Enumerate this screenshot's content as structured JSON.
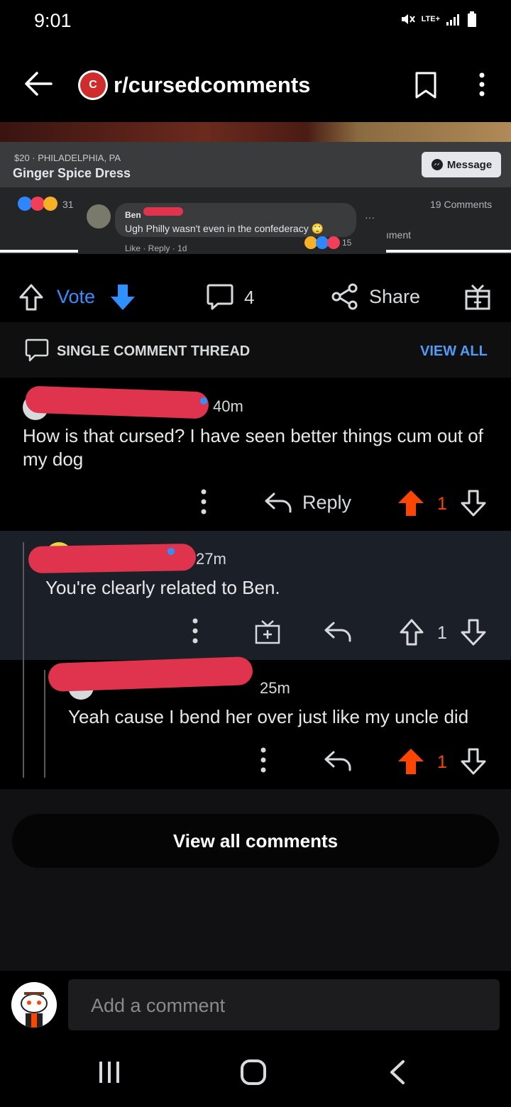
{
  "status_bar": {
    "time": "9:01",
    "network": "LTE+"
  },
  "header": {
    "subreddit": "r/cursedcomments",
    "logo_letter": "C"
  },
  "embed": {
    "price_location": "$20 · PHILADELPHIA, PA",
    "listing_title": "Ginger Spice Dress",
    "message_button": "Message",
    "reaction_count": "31",
    "comments_count": "19 Comments",
    "commenter_name": "Ben",
    "comment_text": "Ugh Philly wasn't even in the confederacy 🙄",
    "comment_actions": "Like · Reply · 1d",
    "comment_reactions": "15",
    "partial_text": "ıment",
    "dots": "···"
  },
  "actions": {
    "vote_label": "Vote",
    "comment_count": "4",
    "share_label": "Share"
  },
  "thread": {
    "label": "SINGLE COMMENT THREAD",
    "view_all": "VIEW ALL"
  },
  "colors": {
    "upvote": "#ff4500",
    "downvote_active": "#2f91ff",
    "link": "#4f9bf8"
  },
  "comments": [
    {
      "time": "40m",
      "text": "How is that cursed? I have seen better things cum out of my dog",
      "reply_label": "Reply",
      "score": "1"
    },
    {
      "time": "27m",
      "text": "You're clearly related to Ben.",
      "score": "1"
    },
    {
      "time": "25m",
      "text": "Yeah cause I bend her over just like my uncle did",
      "score": "1"
    }
  ],
  "footer": {
    "view_all_comments": "View all comments",
    "add_comment_placeholder": "Add a comment"
  }
}
